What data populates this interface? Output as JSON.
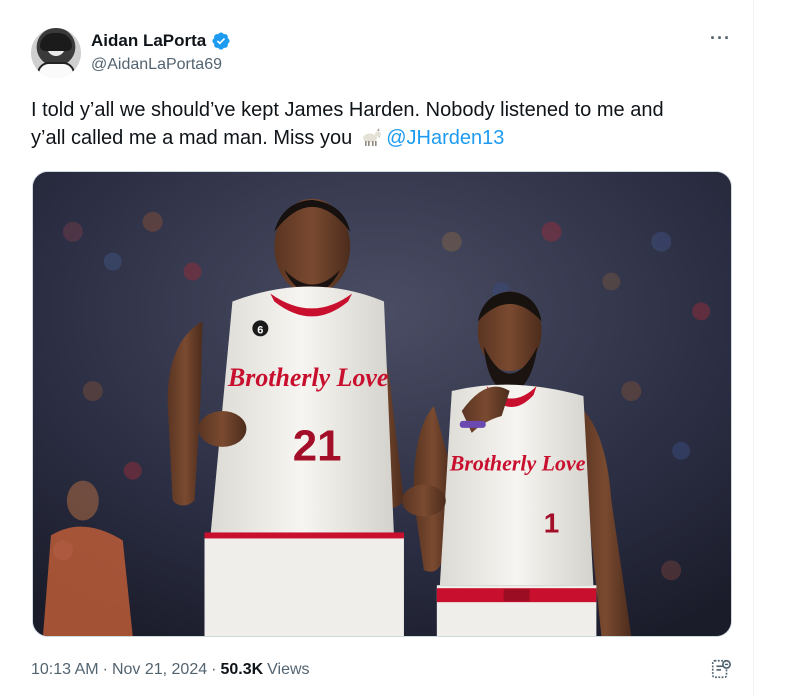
{
  "author": {
    "display_name": "Aidan LaPorta",
    "handle": "@AidanLaPorta69",
    "verified": true
  },
  "tweet": {
    "line1": "I told y’all we should’ve kept James Harden. Nobody listened to me and",
    "line2_text": "y’all called me a mad man. Miss you",
    "line2_emoji": "goat-emoji",
    "mention": "@JHarden13"
  },
  "media": {
    "jersey_left_text": "Brotherly Love",
    "jersey_left_number": "21",
    "jersey_left_badge": "6",
    "jersey_right_text": "Brotherly Love",
    "jersey_right_number": "1"
  },
  "meta": {
    "time": "10:13 AM",
    "separator1": "·",
    "date": "Nov 21, 2024",
    "separator2": "·",
    "views_count": "50.3K",
    "views_label": "Views"
  },
  "icons": {
    "more": "more-icon",
    "verified": "verified-badge-icon",
    "analytics": "analytics-icon"
  },
  "colors": {
    "accent": "#1d9bf0",
    "text_primary": "#0f1419",
    "text_secondary": "#536471",
    "jersey_red": "#c8102e"
  }
}
